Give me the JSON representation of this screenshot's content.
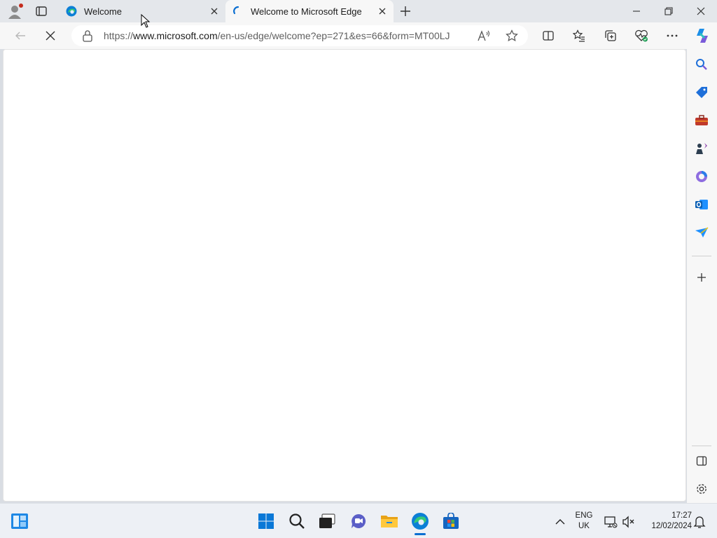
{
  "tabs": [
    {
      "title": "Welcome",
      "favicon": "edge-icon",
      "active": false
    },
    {
      "title": "Welcome to Microsoft Edge",
      "favicon": "loading-spinner-icon",
      "active": true
    }
  ],
  "address": {
    "url_prefix": "https://",
    "url_domain": "www.microsoft.com",
    "url_path": "/en-us/edge/welcome?ep=271&es=66&form=MT00LJ",
    "security_icon": "lock-icon"
  },
  "toolbar_icons": [
    "back-icon",
    "stop-loading-icon",
    "read-aloud-icon",
    "favorite-star-icon",
    "split-screen-icon",
    "favorites-icon",
    "collections-icon",
    "browser-essentials-icon",
    "more-menu-icon",
    "copilot-icon"
  ],
  "sidebar_icons": [
    "search-icon",
    "shopping-icon",
    "tools-icon",
    "games-icon",
    "microsoft-365-icon",
    "outlook-icon",
    "drop-icon",
    "add-icon",
    "sidebar-toggle-icon",
    "settings-icon"
  ],
  "taskbar": {
    "icons": [
      "widgets-icon",
      "start-icon",
      "search-icon",
      "task-view-icon",
      "chat-icon",
      "file-explorer-icon",
      "edge-icon",
      "store-icon"
    ],
    "lang_line1": "ENG",
    "lang_line2": "UK",
    "time": "17:27",
    "date": "12/02/2024"
  },
  "colors": {
    "accent": "#0a6ed1",
    "edge_blue": "#0c7fd6",
    "edge_green": "#34c97a",
    "notification_red": "#c42b1c"
  }
}
